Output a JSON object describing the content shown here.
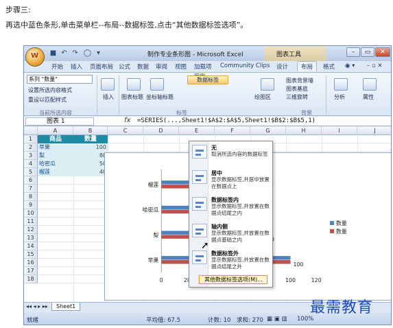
{
  "instructions": {
    "step_title": "步骤三:",
    "step_desc": "再选中蓝色条形,单击菜单栏--布局--数据标签,点击“其他数据标签选项”。"
  },
  "window": {
    "title": "制作专业条形图 - Microsoft Excel",
    "tools_title": "图表工具",
    "office_glyph": "W"
  },
  "tabs": [
    "开始",
    "插入",
    "页面布局",
    "公式",
    "数据",
    "审阅",
    "视图",
    "加载项",
    "Community Clips",
    "设计",
    "布局",
    "格式"
  ],
  "active_tab": "布局",
  "ribbon": {
    "series_selector": "系列 \"数量\"",
    "format_selection": "设置所选内容格式",
    "reset_style": "重设以匹配样式",
    "group_current": "当前所选内容",
    "insert": "插入",
    "chart_title": "图表标题",
    "axis_title": "坐标轴标题",
    "legend": "图例",
    "data_labels": "数据标签",
    "plot_area": "绘图区",
    "chart_wall": "图表背景墙",
    "chart_floor": "图表基底",
    "rotation_3d": "三维旋转",
    "group_background": "背景",
    "group_labels": "标签",
    "analysis": "分析",
    "properties": "属性"
  },
  "formula_bar": {
    "name_box": "图表 1",
    "fx": "fx",
    "formula": "=SERIES(...,Sheet1!$A$2:$A$5,Sheet1!$B$2:$B$5,1)"
  },
  "columns": [
    "A",
    "B",
    "C",
    "D",
    "E",
    "F",
    "G",
    "H",
    "I",
    "J"
  ],
  "rows": [
    "1",
    "2",
    "3",
    "4",
    "5",
    "6",
    "7",
    "8",
    "9",
    "10",
    "11",
    "12",
    "13",
    "14",
    "15",
    "16",
    "17",
    "18"
  ],
  "table": {
    "headers": [
      "商品",
      "数量"
    ],
    "rows": [
      {
        "name": "苹果",
        "value": "100"
      },
      {
        "name": "梨",
        "value": "80"
      },
      {
        "name": "哈密瓜",
        "value": "50"
      },
      {
        "name": "榴莲",
        "value": "40"
      }
    ]
  },
  "data_label_menu": {
    "items": [
      {
        "title": "无",
        "desc": "取消所选内容的数据标签"
      },
      {
        "title": "居中",
        "desc": "显示数据标签,并居中放置在数据点上"
      },
      {
        "title": "数据标签内",
        "desc": "显示数据标签,并放置在数据点结尾之内"
      },
      {
        "title": "轴内侧",
        "desc": "显示数据标签,并放置在数据点基础之内"
      },
      {
        "title": "数据标签外",
        "desc": "显示数据标签,并放置在数据点结尾之外"
      }
    ],
    "more_options": "其他数据标签选项(M)..."
  },
  "chart_data": {
    "type": "bar",
    "orientation": "horizontal",
    "categories": [
      "苹果",
      "梨",
      "哈密瓜",
      "榴莲"
    ],
    "series": [
      {
        "name": "数量",
        "values": [
          100,
          80,
          50,
          40
        ],
        "color": "#4f81bd"
      },
      {
        "name": "数量",
        "values": [
          100,
          80,
          50,
          40
        ],
        "color": "#c0504d"
      }
    ],
    "data_labels": [
      "100",
      "80"
    ],
    "x_ticks": [
      "0",
      "20",
      "40",
      "60",
      "80",
      "100",
      "120"
    ],
    "xlim": [
      0,
      120
    ],
    "legend": "right",
    "grid": false
  },
  "sheet_tab": "Sheet1",
  "status": {
    "ready": "就绪",
    "average": "平均值: 67.5",
    "count": "计数: 10",
    "sum": "求和: 270",
    "zoom": "100%"
  },
  "watermark": "最需教育"
}
